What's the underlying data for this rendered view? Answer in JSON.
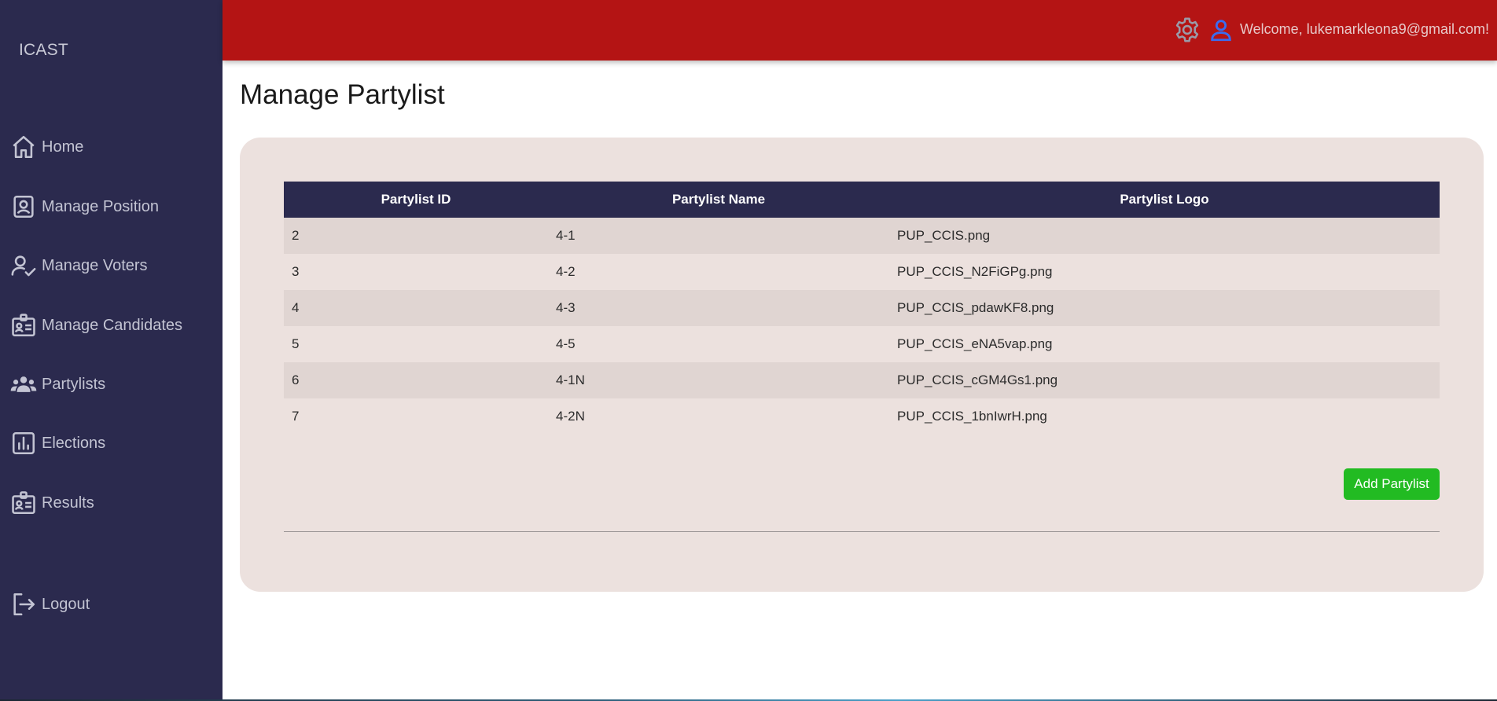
{
  "app": {
    "brand": "ICAST"
  },
  "sidebar": {
    "items": [
      {
        "label": "Home",
        "icon": "home-icon"
      },
      {
        "label": "Manage Position",
        "icon": "position-badge-icon"
      },
      {
        "label": "Manage Voters",
        "icon": "user-check-icon"
      },
      {
        "label": "Manage Candidates",
        "icon": "id-card-icon"
      },
      {
        "label": "Partylists",
        "icon": "group-icon"
      },
      {
        "label": "Elections",
        "icon": "bar-chart-icon"
      },
      {
        "label": "Results",
        "icon": "id-card-icon"
      }
    ],
    "logout_label": "Logout"
  },
  "header": {
    "welcome": "Welcome, lukemarkleona9@gmail.com!",
    "settings_icon": "gear-icon",
    "user_icon": "user-icon",
    "colors": {
      "header_bg": "#b41414",
      "sidebar_bg": "#2b2a4e",
      "user_icon": "#3a6cf0"
    }
  },
  "main": {
    "title": "Manage Partylist",
    "table": {
      "headers": [
        "Partylist ID",
        "Partylist Name",
        "Partylist Logo"
      ],
      "rows": [
        {
          "id": "2",
          "name": "4-1",
          "logo": "PUP_CCIS.png"
        },
        {
          "id": "3",
          "name": "4-2",
          "logo": "PUP_CCIS_N2FiGPg.png"
        },
        {
          "id": "4",
          "name": "4-3",
          "logo": "PUP_CCIS_pdawKF8.png"
        },
        {
          "id": "5",
          "name": "4-5",
          "logo": "PUP_CCIS_eNA5vap.png"
        },
        {
          "id": "6",
          "name": "4-1N",
          "logo": "PUP_CCIS_cGM4Gs1.png"
        },
        {
          "id": "7",
          "name": "4-2N",
          "logo": "PUP_CCIS_1bnIwrH.png"
        }
      ]
    },
    "add_button": {
      "label": "Add Partylist",
      "color": "#22bb22"
    }
  }
}
